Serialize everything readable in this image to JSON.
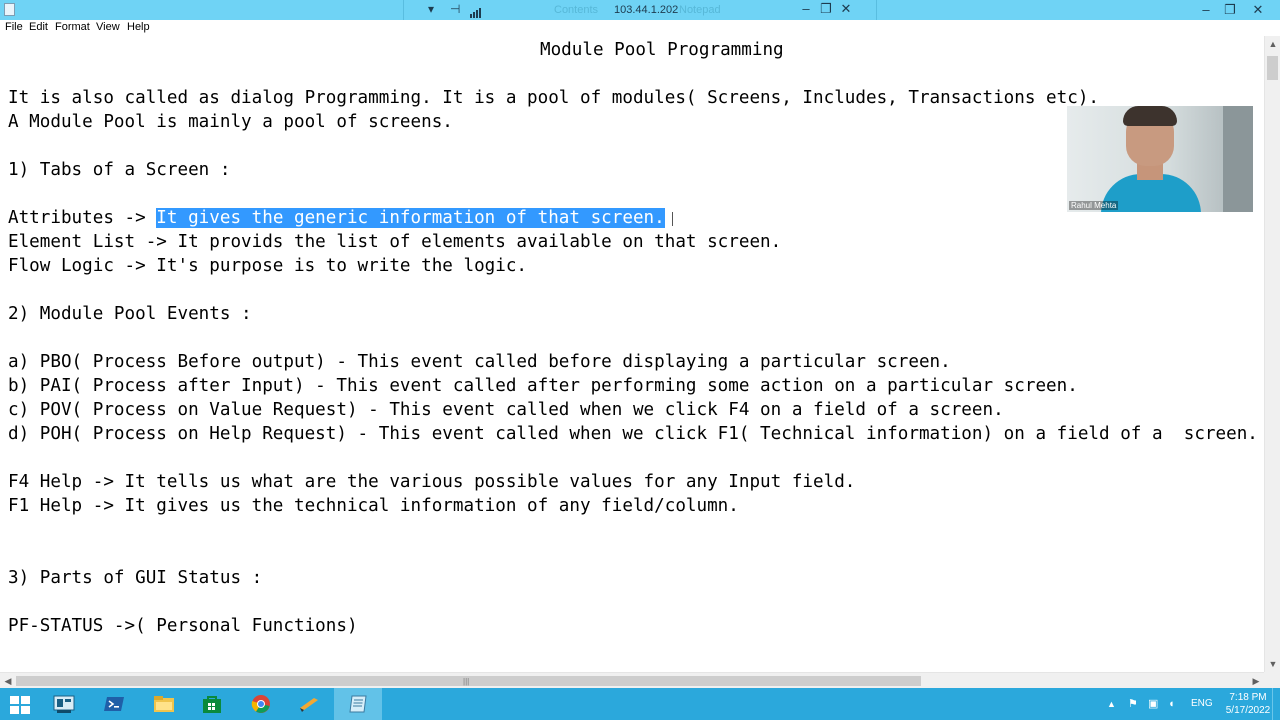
{
  "rdp": {
    "ghost_left": "Contents",
    "title": "103.44.1.202",
    "ghost_right": "Notepad"
  },
  "menu": [
    "File",
    "Edit",
    "Format",
    "View",
    "Help"
  ],
  "document": {
    "title_line": "Module Pool Programming",
    "lines": [
      "It is also called as dialog Programming. It is a pool of modules( Screens, Includes, Transactions etc).",
      "A Module Pool is mainly a pool of screens.",
      "1) Tabs of a Screen :",
      "Attributes -> ",
      "It gives the generic information of that screen.",
      "Element List -> It provids the list of elements available on that screen.",
      "Flow Logic -> It's purpose is to write the logic.",
      "2) Module Pool Events :",
      "a) PBO( Process Before output) - This event called before displaying a particular screen.",
      "b) PAI( Process after Input) - This event called after performing some action on a particular screen.",
      "c) POV( Process on Value Request) - This event called when we click F4 on a field of a screen.",
      "d) POH( Process on Help Request) - This event called when we click F1( Technical information) on a field of a  screen.",
      "F4 Help -> It tells us what are the various possible values for any Input field.",
      "F1 Help -> It gives us the technical information of any field/column.",
      "3) Parts of GUI Status :",
      "PF-STATUS ->( Personal Functions)"
    ]
  },
  "webcam": {
    "name": "Rahul Mehta"
  },
  "taskbar": {
    "language": "ENG",
    "time": "7:18 PM",
    "date": "5/17/2022"
  },
  "colors": {
    "title_bar": "#6fd3f5",
    "selection": "#3399ff",
    "taskbar": "#2ba8dc"
  }
}
